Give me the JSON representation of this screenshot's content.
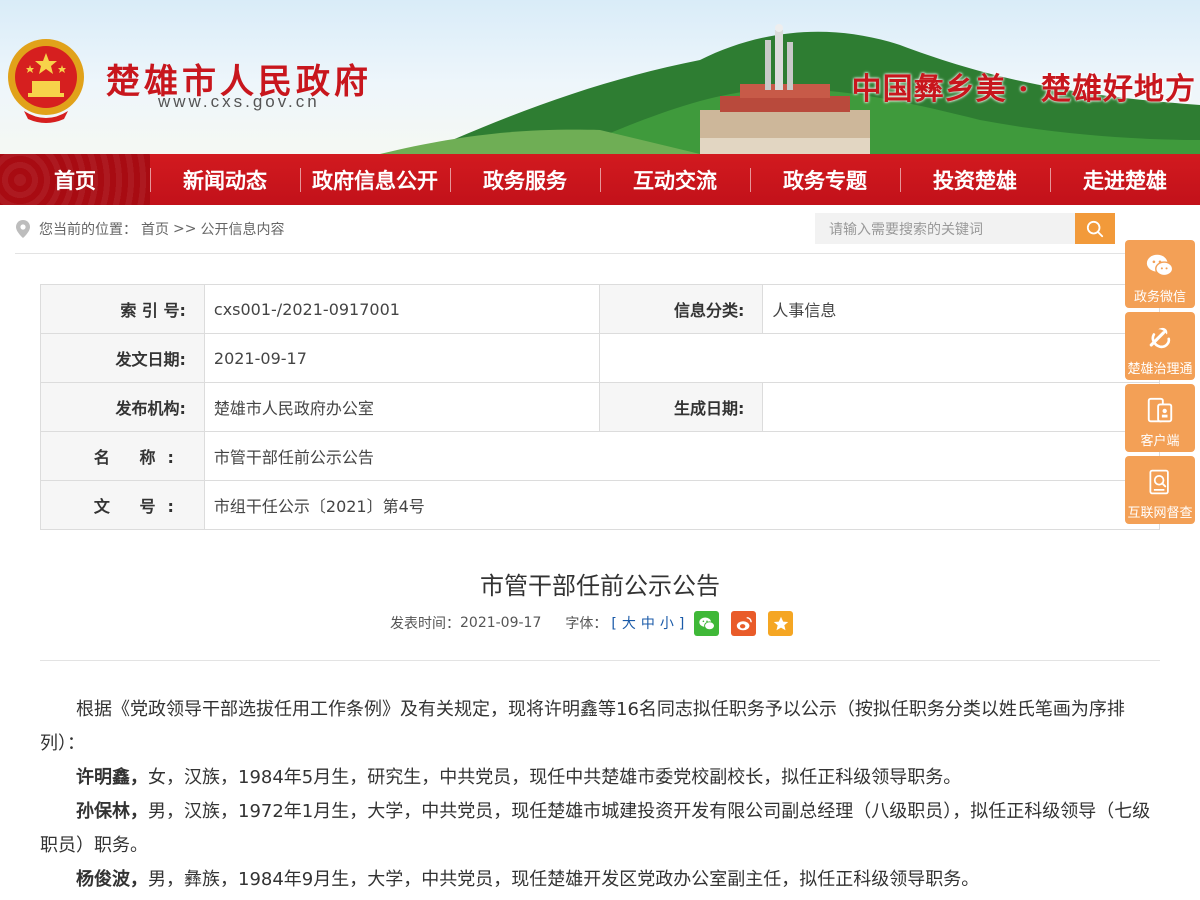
{
  "header": {
    "site_title": "楚雄市人民政府",
    "site_url": "www.cxs.gov.cn",
    "slogan": "中国彝乡美 · 楚雄好地方"
  },
  "nav": {
    "items": [
      {
        "label": "首页",
        "active": true
      },
      {
        "label": "新闻动态"
      },
      {
        "label": "政府信息公开"
      },
      {
        "label": "政务服务"
      },
      {
        "label": "互动交流"
      },
      {
        "label": "政务专题"
      },
      {
        "label": "投资楚雄"
      },
      {
        "label": "走进楚雄"
      }
    ]
  },
  "breadcrumb": {
    "prefix": "您当前的位置：",
    "home": "首页",
    "sep": ">>",
    "current": "公开信息内容"
  },
  "search": {
    "placeholder": "请输入需要搜索的关键词"
  },
  "info_table": {
    "index_label": "索 引 号:",
    "index_value": "cxs001-/2021-0917001",
    "category_label": "信息分类:",
    "category_value": "人事信息",
    "issue_date_label": "发文日期:",
    "issue_date_value": "2021-09-17",
    "publisher_label": "发布机构:",
    "publisher_value": "楚雄市人民政府办公室",
    "effective_date_label": "生成日期:",
    "effective_date_value": "",
    "name_label": "名 称:",
    "name_value": "市管干部任前公示公告",
    "doc_no_label": "文 号:",
    "doc_no_value": "市组干任公示〔2021〕第4号"
  },
  "article": {
    "title": "市管干部任前公示公告",
    "publish_label": "发表时间：",
    "publish_date": "2021-09-17",
    "font_label": "字体：",
    "font_open": "[",
    "font_large": "大",
    "font_medium": "中",
    "font_small": "小",
    "font_close": "]",
    "intro": "根据《党政领导干部选拔任用工作条例》及有关规定，现将许明鑫等16名同志拟任职务予以公示（按拟任职务分类以姓氏笔画为序排列）：",
    "persons": [
      {
        "name": "许明鑫，",
        "desc": "女，汉族，1984年5月生，研究生，中共党员，现任中共楚雄市委党校副校长，拟任正科级领导职务。"
      },
      {
        "name": "孙保林，",
        "desc": "男，汉族，1972年1月生，大学，中共党员，现任楚雄市城建投资开发有限公司副总经理（八级职员），拟任正科级领导（七级职员）职务。"
      },
      {
        "name": "杨俊波，",
        "desc": "男，彝族，1984年9月生，大学，中共党员，现任楚雄开发区党政办公室副主任，拟任正科级领导职务。"
      }
    ]
  },
  "float_bar": [
    {
      "label": "政务微信",
      "icon": "wechat-icon"
    },
    {
      "label": "楚雄治理通",
      "icon": "party-emblem-icon"
    },
    {
      "label": "客户端",
      "icon": "mobile-app-icon"
    },
    {
      "label": "互联网督查",
      "icon": "inspection-icon"
    }
  ],
  "colors": {
    "brand_red": "#c8161d",
    "accent_orange": "#f29a3a",
    "float_orange": "#f3a056",
    "link_blue": "#1a5aa8"
  }
}
